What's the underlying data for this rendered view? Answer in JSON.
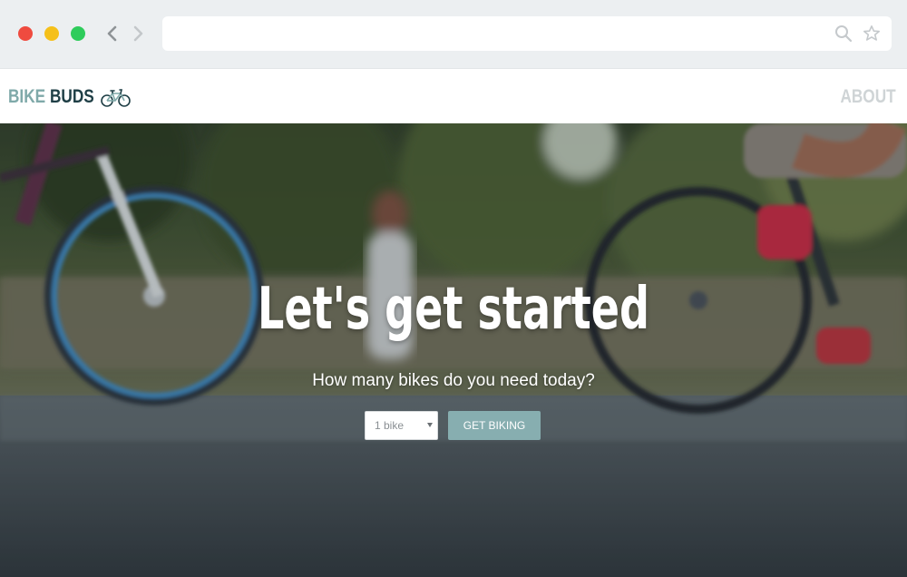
{
  "browser": {
    "window_controls": [
      "close",
      "minimize",
      "maximize"
    ],
    "nav": {
      "back_icon": "chevron-left-icon",
      "forward_icon": "chevron-right-icon"
    },
    "address_bar": {
      "value": "",
      "icons": [
        "search-icon",
        "star-icon"
      ]
    }
  },
  "header": {
    "logo": {
      "part1": "BIKE",
      "part2": "BUDS",
      "icon": "bicycle-icon"
    },
    "nav_link": "ABOUT"
  },
  "hero": {
    "title": "Let's get started",
    "subtitle": "How many bikes do you need today?",
    "select": {
      "selected": "1 bike"
    },
    "button": "GET BIKING"
  },
  "colors": {
    "logo_accent": "#7fa9a9",
    "logo_dark": "#1f3f46",
    "nav_link": "#cfd4d6",
    "button": "#87aeb0"
  }
}
